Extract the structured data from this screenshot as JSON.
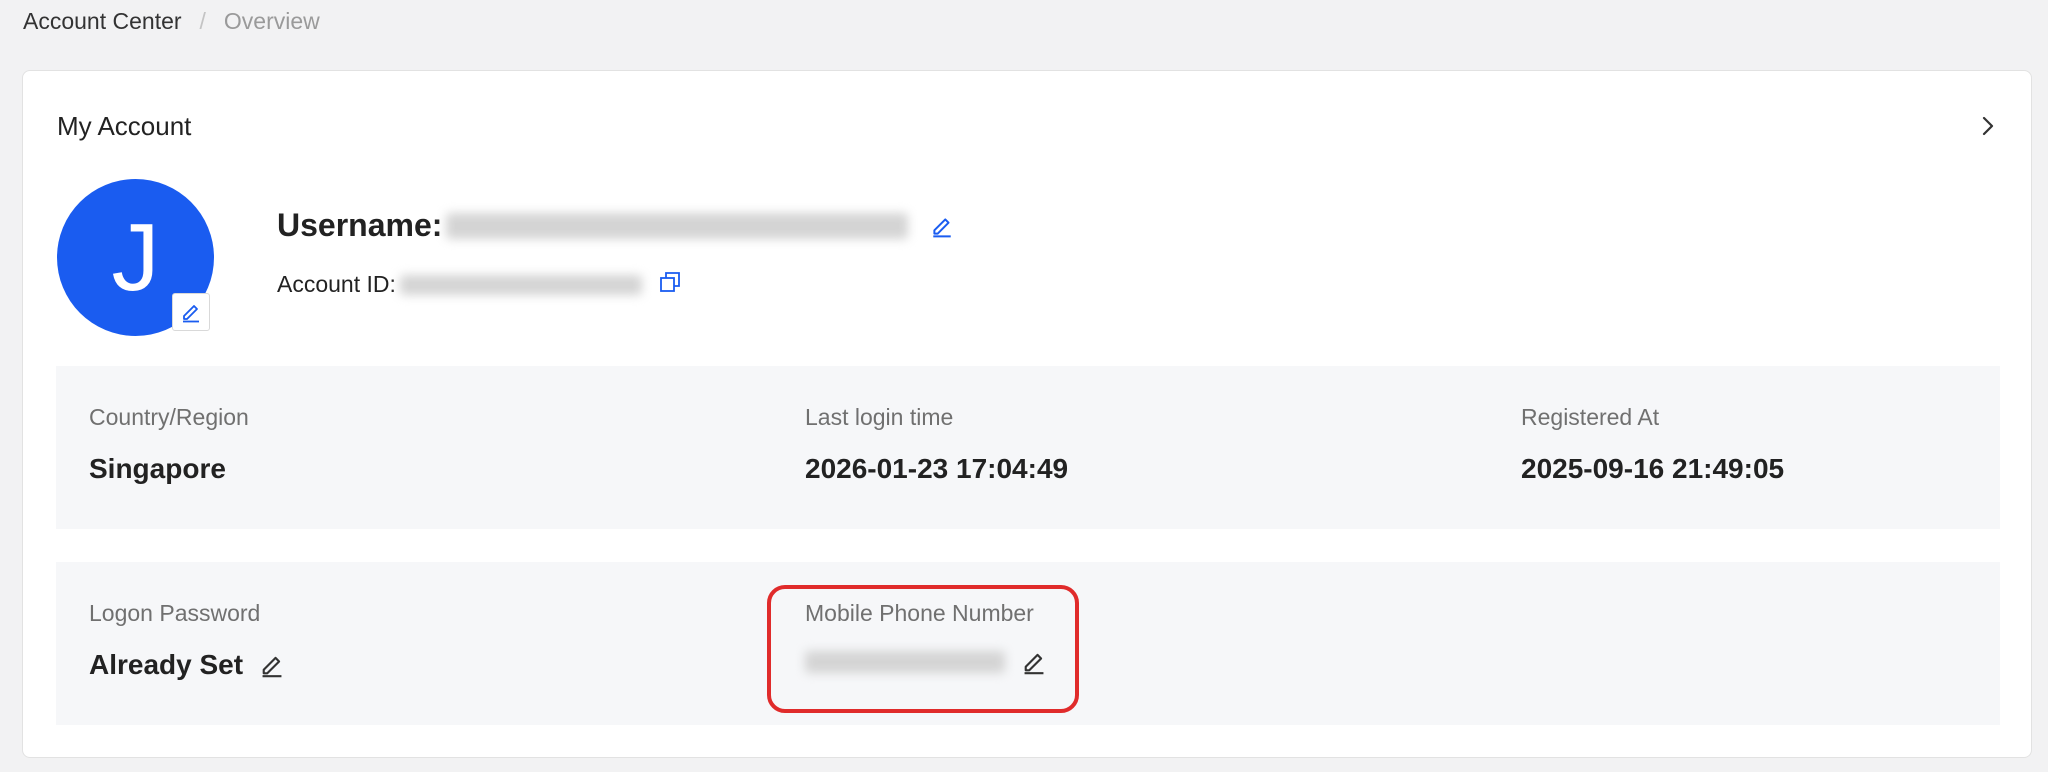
{
  "breadcrumb": {
    "items": [
      "Account Center",
      "Overview"
    ],
    "separator": "/"
  },
  "card": {
    "title": "My Account",
    "avatar_initial": "J",
    "username_label": "Username:",
    "account_id_label": "Account ID:"
  },
  "info_panel": {
    "country_label": "Country/Region",
    "country_value": "Singapore",
    "last_login_label": "Last login time",
    "last_login_value": "2026-01-23 17:04:49",
    "registered_label": "Registered At",
    "registered_value": "2025-09-16 21:49:05"
  },
  "security_panel": {
    "password_label": "Logon Password",
    "password_value": "Already Set",
    "phone_label": "Mobile Phone Number"
  },
  "colors": {
    "accent": "#1a5cf0",
    "highlight": "#e02b2b",
    "panel_bg": "#f6f7f9"
  },
  "icons": {
    "edit": "pencil-edit-icon",
    "copy": "copy-icon",
    "chevron": "chevron-right-icon"
  }
}
